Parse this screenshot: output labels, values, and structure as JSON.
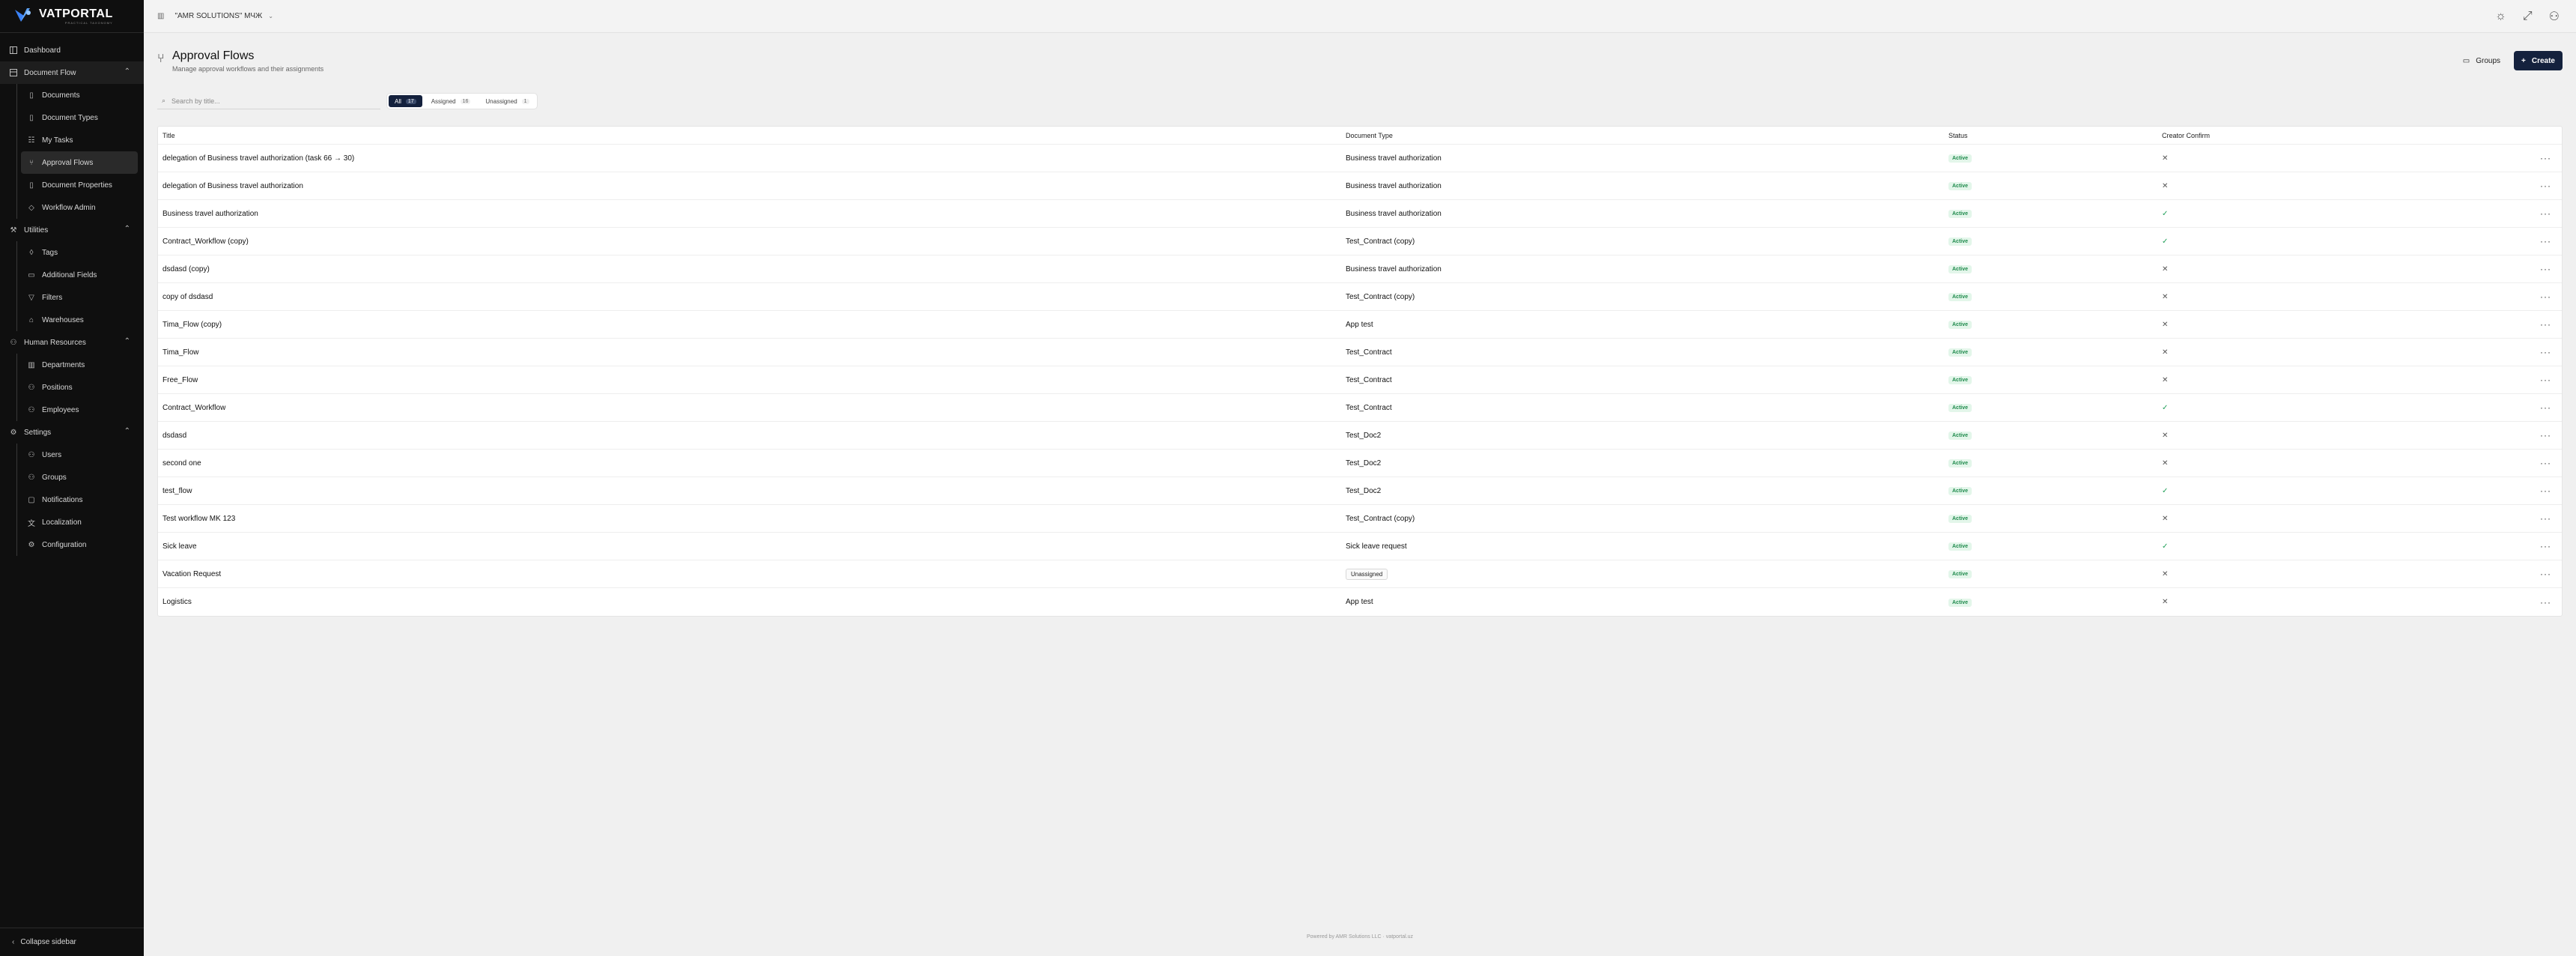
{
  "brand": {
    "title": "VATPORTAL",
    "subtitle": "PRACTICAL TAXONOMY"
  },
  "topbar": {
    "organization": "\"AMR SOLUTIONS\" МЧЖ"
  },
  "sidebar": {
    "dashboard": "Dashboard",
    "document_flow": {
      "label": "Document Flow",
      "items": [
        "Documents",
        "Document Types",
        "My Tasks",
        "Approval Flows",
        "Document Properties",
        "Workflow Admin"
      ]
    },
    "utilities": {
      "label": "Utilities",
      "items": [
        "Tags",
        "Additional Fields",
        "Filters",
        "Warehouses"
      ]
    },
    "human_resources": {
      "label": "Human Resources",
      "items": [
        "Departments",
        "Positions",
        "Employees"
      ]
    },
    "settings": {
      "label": "Settings",
      "items": [
        "Users",
        "Groups",
        "Notifications",
        "Localization",
        "Configuration"
      ]
    },
    "collapse_label": "Collapse sidebar"
  },
  "page": {
    "title": "Approval Flows",
    "subtitle": "Manage approval workflows and their assignments",
    "groups_label": "Groups",
    "create_label": "Create",
    "search_placeholder": "Search by title..."
  },
  "filters": [
    {
      "label": "All",
      "count": "17"
    },
    {
      "label": "Assigned",
      "count": "16"
    },
    {
      "label": "Unassigned",
      "count": "1"
    }
  ],
  "table": {
    "headers": {
      "title": "Title",
      "document_type": "Document Type",
      "status": "Status",
      "creator_confirm": "Creator Confirm"
    },
    "rows": [
      {
        "title": "delegation of Business travel authorization (task 66 → 30)",
        "document_type": "Business travel authorization",
        "status": "Active",
        "creator_confirm": false
      },
      {
        "title": "delegation of Business travel authorization",
        "document_type": "Business travel authorization",
        "status": "Active",
        "creator_confirm": false
      },
      {
        "title": "Business travel authorization",
        "document_type": "Business travel authorization",
        "status": "Active",
        "creator_confirm": true
      },
      {
        "title": "Contract_Workflow (copy)",
        "document_type": "Test_Contract (copy)",
        "status": "Active",
        "creator_confirm": true
      },
      {
        "title": "dsdasd (copy)",
        "document_type": "Business travel authorization",
        "status": "Active",
        "creator_confirm": false
      },
      {
        "title": "copy of dsdasd",
        "document_type": "Test_Contract (copy)",
        "status": "Active",
        "creator_confirm": false
      },
      {
        "title": "Tima_Flow (copy)",
        "document_type": "App test",
        "status": "Active",
        "creator_confirm": false
      },
      {
        "title": "Tima_Flow",
        "document_type": "Test_Contract",
        "status": "Active",
        "creator_confirm": false
      },
      {
        "title": "Free_Flow",
        "document_type": "Test_Contract",
        "status": "Active",
        "creator_confirm": false
      },
      {
        "title": "Contract_Workflow",
        "document_type": "Test_Contract",
        "status": "Active",
        "creator_confirm": true
      },
      {
        "title": "dsdasd",
        "document_type": "Test_Doc2",
        "status": "Active",
        "creator_confirm": false
      },
      {
        "title": "second one",
        "document_type": "Test_Doc2",
        "status": "Active",
        "creator_confirm": false
      },
      {
        "title": "test_flow",
        "document_type": "Test_Doc2",
        "status": "Active",
        "creator_confirm": true
      },
      {
        "title": "Test workflow MK 123",
        "document_type": "Test_Contract (copy)",
        "status": "Active",
        "creator_confirm": false
      },
      {
        "title": "Sick leave",
        "document_type": "Sick leave request",
        "status": "Active",
        "creator_confirm": true
      },
      {
        "title": "Vacation Request",
        "document_type": "Unassigned",
        "document_type_tag": true,
        "status": "Active",
        "creator_confirm": false
      },
      {
        "title": "Logistics",
        "document_type": "App test",
        "status": "Active",
        "creator_confirm": false
      }
    ]
  },
  "footer": "Powered by AMR Solutions LLC · vatportal.uz",
  "colors": {
    "accent": "#14213d",
    "active_badge": "#1f8a4c",
    "sidebar_bg": "#0f0f0f"
  }
}
